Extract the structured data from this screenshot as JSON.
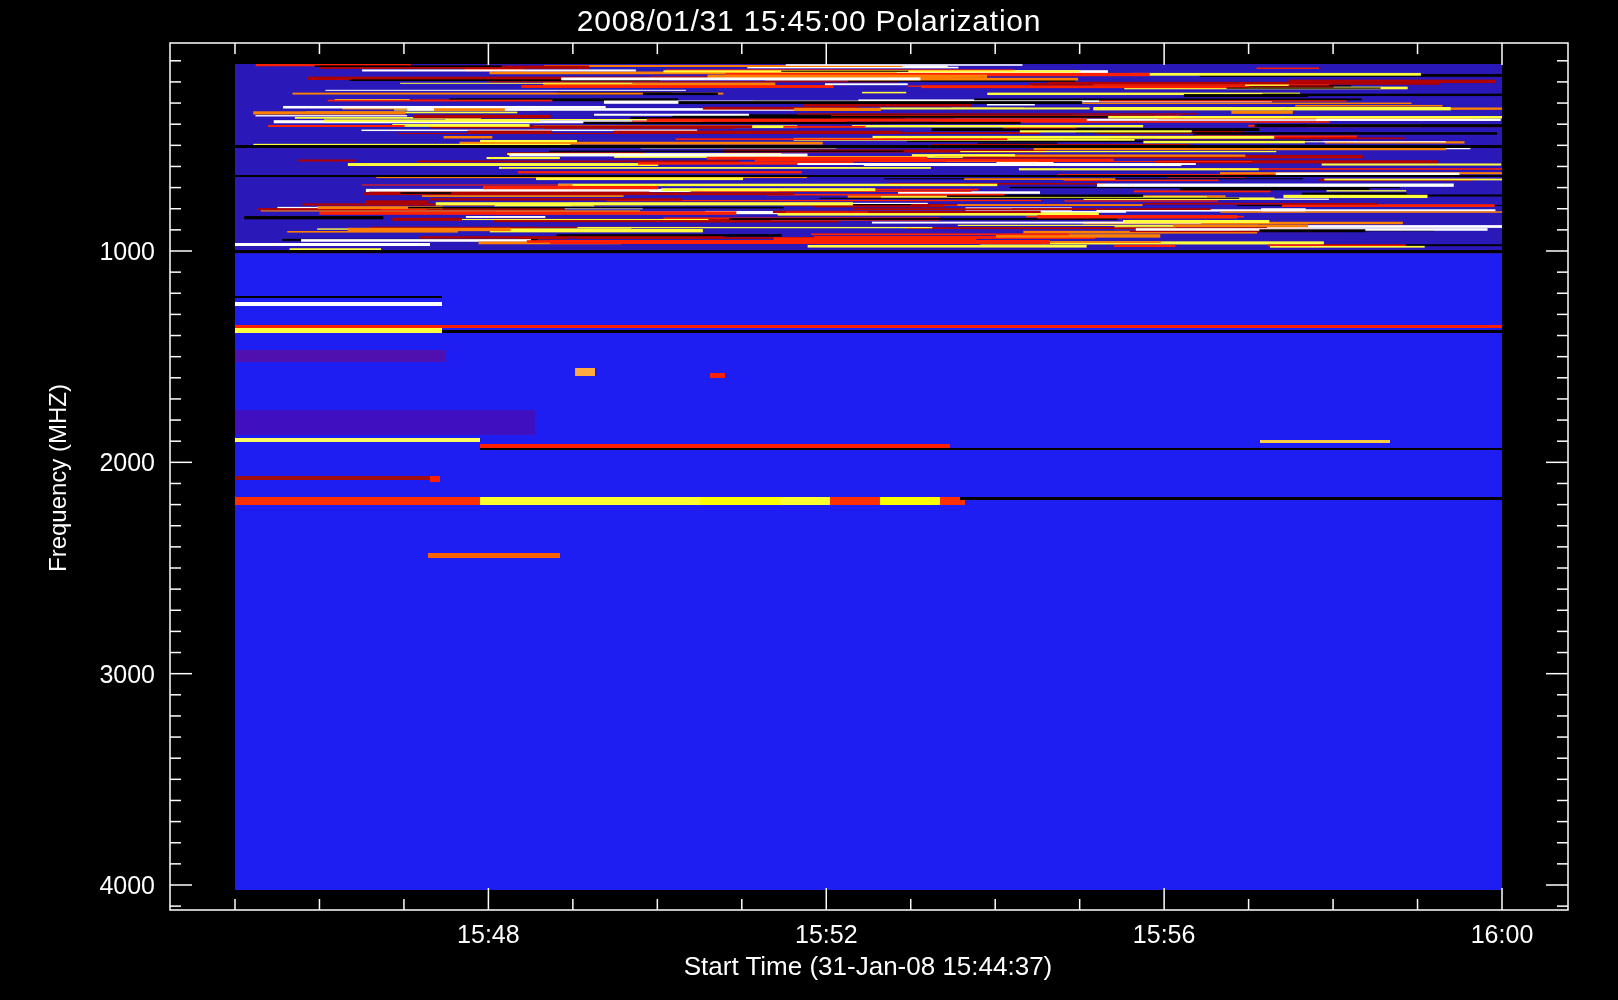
{
  "title": "2008/01/31 15:45:00 Polarization",
  "y_axis": {
    "label": "Frequency (MHZ)",
    "ticks": [
      "1000",
      "2000",
      "3000",
      "4000"
    ]
  },
  "x_axis": {
    "label": "Start Time (31-Jan-08 15:44:37)",
    "ticks": [
      "15:48",
      "15:52",
      "15:56",
      "16:00"
    ]
  }
}
